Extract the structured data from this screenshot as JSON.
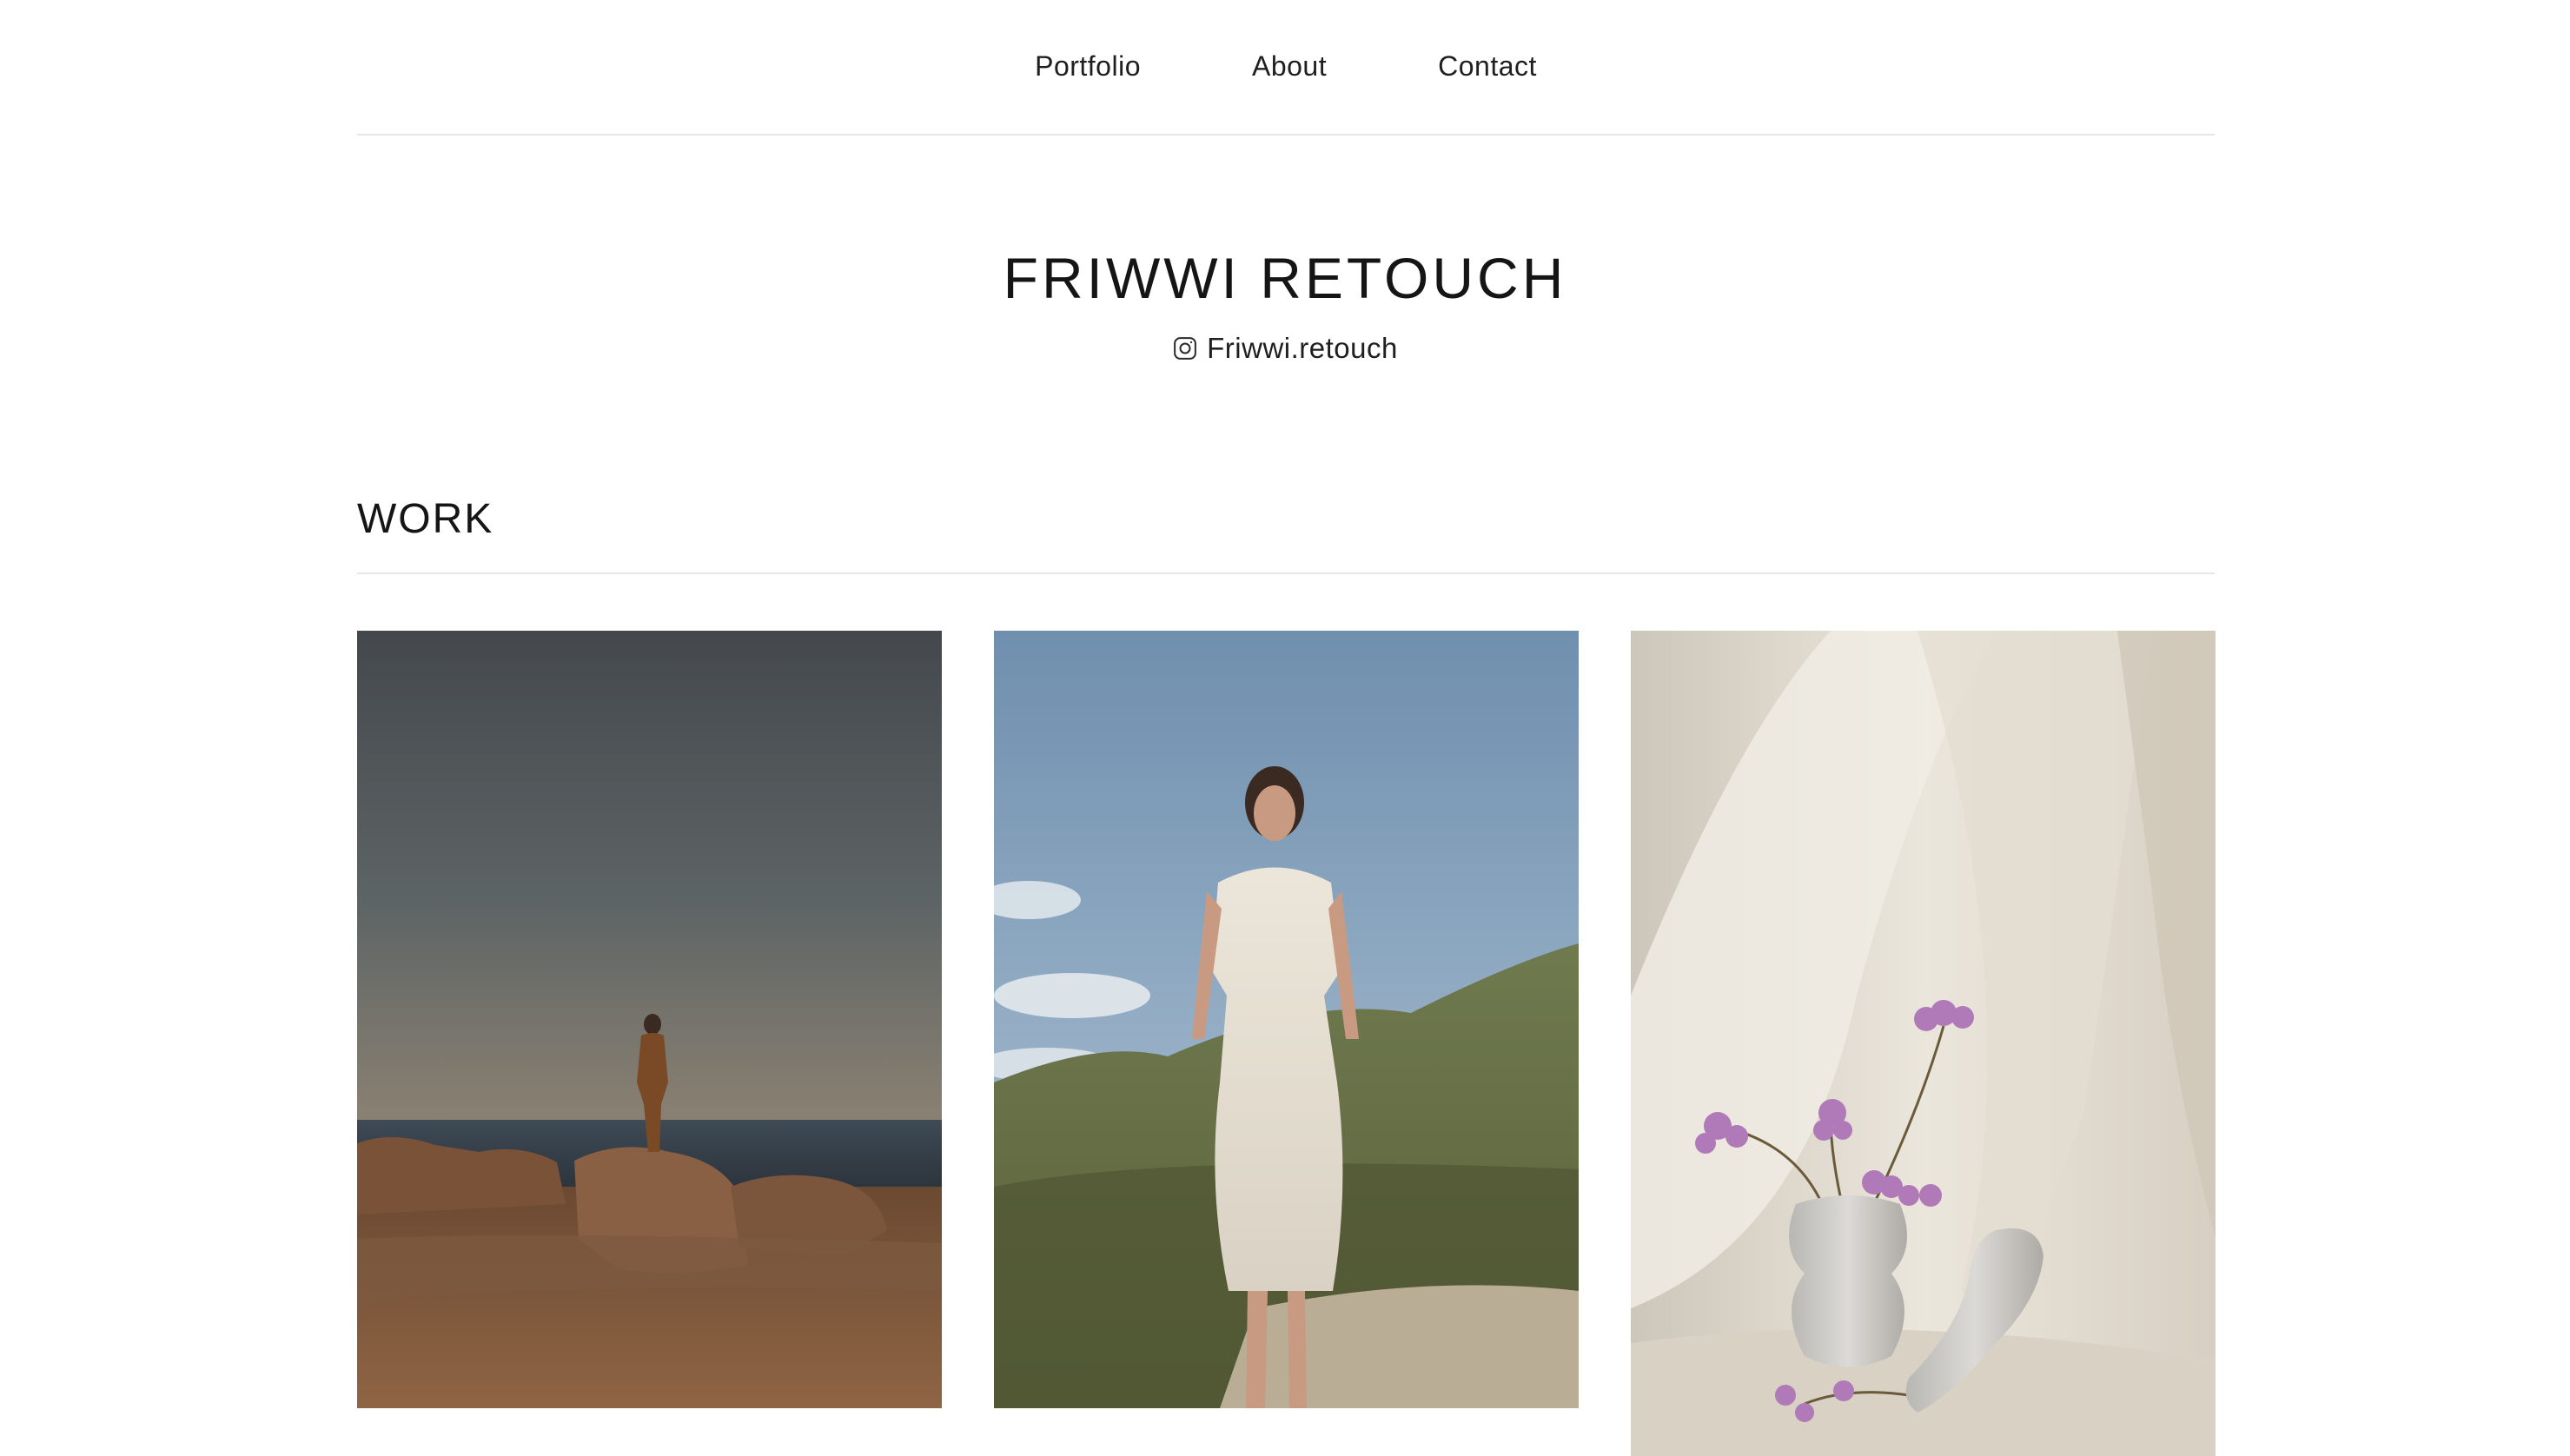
{
  "nav": {
    "items": [
      {
        "label": "Portfolio"
      },
      {
        "label": "About"
      },
      {
        "label": "Contact"
      }
    ]
  },
  "header": {
    "title": "FRIWWI RETOUCH",
    "social": {
      "icon": "instagram-icon",
      "handle": "Friwwi.retouch"
    }
  },
  "work": {
    "heading": "WORK",
    "gallery": [
      {
        "subject": "woman-on-rocks-by-sea"
      },
      {
        "subject": "woman-in-white-dress-in-dunes"
      },
      {
        "subject": "vase-with-purple-flowers"
      }
    ]
  },
  "colors": {
    "divider": "#e6e6e6",
    "text": "#1a1a1a",
    "background": "#ffffff"
  }
}
